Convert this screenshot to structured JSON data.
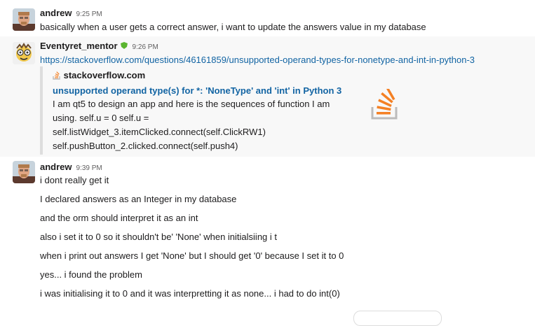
{
  "messages": [
    {
      "author": "andrew",
      "time": "9:25 PM",
      "lines": [
        "basically when a user gets a correct answer, i want to update the answers value in my database"
      ]
    },
    {
      "author": "Eventyret_mentor",
      "time": "9:26 PM",
      "link": "https://stackoverflow.com/questions/46161859/unsupported-operand-types-for-nonetype-and-int-in-python-3",
      "attachment": {
        "site": "stackoverflow.com",
        "title": "unsupported operand type(s) for *: 'NoneType' and 'int' in Python 3",
        "body": [
          "I am qt5 to design an app and here is the sequences of function I am",
          "using. self.u = 0 self.u =",
          "self.listWidget_3.itemClicked.connect(self.ClickRW1)",
          "self.pushButton_2.clicked.connect(self.push4)"
        ]
      }
    },
    {
      "author": "andrew",
      "time": "9:39 PM",
      "lines": [
        "i dont really get it",
        "I declared answers as an Integer in my database",
        "and the orm should interpret it as an int",
        "also i set it to 0 so it shouldn't be' 'None' when initialsiing i t",
        "when i print out answers I get 'None' but I should get '0' because I set it to 0",
        "yes... i found the problem",
        "i was initialising it to 0 and it was interpretting it as none... i had to do int(0)"
      ]
    }
  ],
  "icons": {
    "avatar_andrew": "user-avatar-photo",
    "avatar_mentor": "cartoon-avatar",
    "badge": "green-shield-badge",
    "so_logo": "stackoverflow-logo"
  },
  "colors": {
    "link": "#1264a3",
    "highlight_bg": "#f8f8f8",
    "so_orange": "#f48024",
    "badge_green": "#5ab52f"
  }
}
